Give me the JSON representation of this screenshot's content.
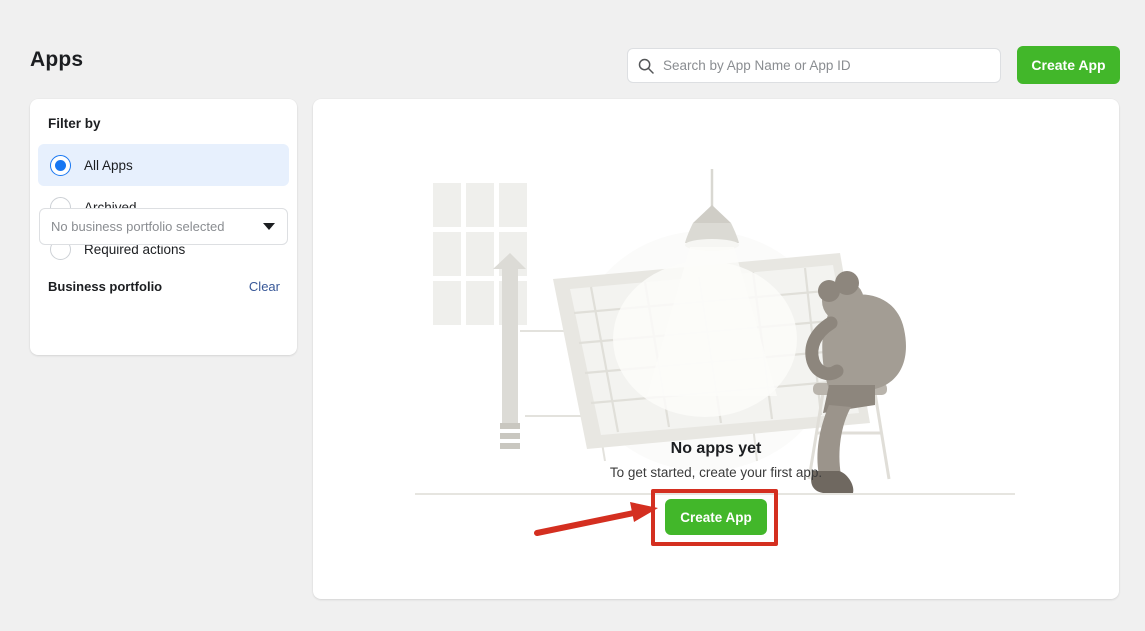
{
  "header": {
    "title": "Apps",
    "search": {
      "placeholder": "Search by App Name or App ID",
      "value": "",
      "icon": "search-icon"
    },
    "create_app_label": "Create App"
  },
  "sidebar": {
    "filter_title": "Filter by",
    "filters": [
      {
        "label": "All Apps",
        "selected": true
      },
      {
        "label": "Archived",
        "selected": false
      },
      {
        "label": "Required actions",
        "selected": false
      }
    ],
    "portfolio": {
      "title": "Business portfolio",
      "clear_label": "Clear",
      "selected_value": "No business portfolio selected",
      "caret_icon": "chevron-down-icon"
    }
  },
  "main": {
    "empty_state": {
      "illustration": "person-at-drafting-board-illustration",
      "title": "No apps yet",
      "subtitle": "To get started, create your first app.",
      "create_app_label": "Create App"
    }
  },
  "annotation": {
    "highlight_box": "red-rectangle-around-create-app",
    "arrow": "red-arrow-pointing-to-create-app"
  },
  "colors": {
    "page_background": "#f0f0f0",
    "card_background": "#ffffff",
    "accent_green": "#42b72a",
    "accent_blue": "#1877f2",
    "link_blue": "#385898",
    "selected_row": "#e7f0fd",
    "annotation_red": "#d42f20",
    "text_primary": "#1c1e21",
    "text_muted": "#8a8d91"
  }
}
